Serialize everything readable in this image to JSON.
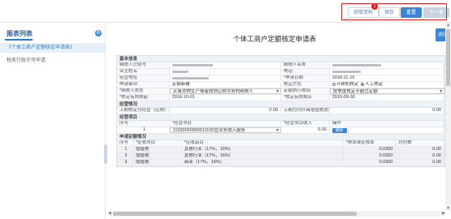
{
  "toolbar": {
    "fetch_label": "获取资料",
    "save_label": "保存",
    "back_label": "重置",
    "next_label": "下一步",
    "badge_count": "1"
  },
  "sidebar": {
    "title": "报表列表",
    "icon": "gear-icon",
    "items": [
      {
        "label": "《个体工商户定额核定申请表》"
      },
      {
        "label": "税务行政许可申请"
      }
    ]
  },
  "main": {
    "form_title": "个体工商户定额核定申请表",
    "return_label": "返回"
  },
  "basic": {
    "section": "基本信息",
    "taxpayer_id_label": "纳税人识别号",
    "taxpayer_name_label": "纳税人名称",
    "owner_label": "业主姓名",
    "phone_label": "电话",
    "address_label": "经营地址",
    "apply_date_label": "*申请日期",
    "apply_date": "2018-11-16",
    "apply_type_label": "申请事项",
    "apply_type": "定额新建",
    "method_label": "核定方式",
    "method_opt1": "计算机核定",
    "method_opt2": "人工核定",
    "taxpayer_type_label": "*纳税人类型",
    "taxpayer_type": "从事货物生产或者提供应税劳务的纳税人",
    "period_type_label": "定额执行期间",
    "period_type": "按季度核定不超过定额",
    "start_label": "*核定有效期起",
    "start": "2018-10-01",
    "end_label": "*核定有效期止",
    "end": "2019-09-30"
  },
  "biz": {
    "section": "经营情况",
    "prev_label": "上期核定月经营（应税）额",
    "prev_value": "0.00",
    "month_label": "上期月均开具增值税发票金额",
    "month_value": "0.00"
  },
  "item": {
    "section": "经营项目",
    "col_seq": "序号",
    "col_item": "*经营项目",
    "col_amount": "*经营项目收入",
    "col_op": "操作",
    "rows": [
      {
        "seq": "1",
        "item": "11500000000011100营业务收入服务",
        "amount": "0.00",
        "op": "删除"
      }
    ]
  },
  "tax": {
    "section": "申请定额情况",
    "col_seq": "序号",
    "col_tax": "*征收项目",
    "col_sub": "*征收品目",
    "col_amount": "*税率或征收率",
    "col_income": "月份数",
    "rows": [
      {
        "seq": "1",
        "tax": "增值税",
        "sub": "其他行业（17%，16%）",
        "amount": "0.0300",
        "income": "0.00"
      },
      {
        "seq": "2",
        "tax": "增值税",
        "sub": "其他行业（17%，16%）",
        "amount": "0.0300",
        "income": "0.00"
      },
      {
        "seq": "3",
        "tax": "增值税",
        "sub": "商业（17%，16%）",
        "amount": "0.0300",
        "income": "0.00"
      }
    ]
  }
}
